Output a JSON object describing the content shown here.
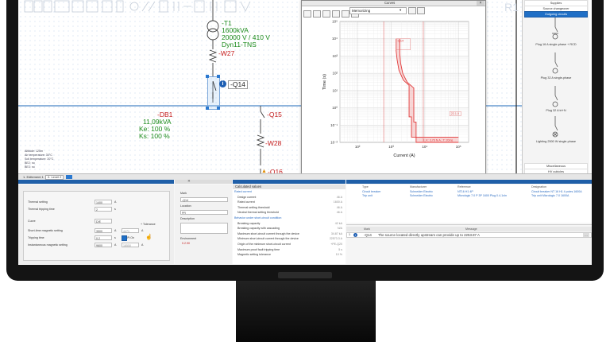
{
  "diagram": {
    "transformer": {
      "name": "-T1",
      "power": "1600kVA",
      "voltage": "20000 V / 410 V",
      "coupling": "Dyn11-TNS"
    },
    "cable_w27": "-W27",
    "breaker_q14": "-Q14",
    "breaker_q15": "-Q15",
    "cable_w28": "-W28",
    "breaker_q16": "-Q16",
    "db1": {
      "name": "-DB1",
      "power": "11,09kVA",
      "ke": "Ke: 100 %",
      "ks": "Ks: 100 %"
    },
    "env_notes": [
      "Altitude: 125m",
      "Air temperature: 30°C",
      "Soil temperature: 20°C",
      "BE2: no",
      "BE3: no"
    ],
    "faded_label": "R1"
  },
  "curve_window": {
    "title": "Curves",
    "mode": "Memorizing",
    "chart": {
      "y_axis_label": "Time (s)",
      "x_axis_label": "Current (A)",
      "y_ticks": [
        "10⁵",
        "10⁴",
        "10³",
        "10²",
        "10¹",
        "10⁰",
        "10⁻¹",
        "10⁻²"
      ],
      "x_ticks": [
        "10²",
        "10³",
        "10⁴",
        "10⁵"
      ],
      "top_label": "-Q14",
      "annotation_ik": "I_K: 3,76 N.A.; T: 20ms",
      "annotation_ir": "22.1.0"
    }
  },
  "chart_data": {
    "type": "line",
    "title": "",
    "xlabel": "Current (A)",
    "ylabel": "Time (s)",
    "x_scale": "log",
    "y_scale": "log",
    "xlim": [
      30,
      200000
    ],
    "ylim": [
      0.01,
      100000
    ],
    "series": [
      {
        "name": "-Q14",
        "points": [
          [
            1400,
            10000
          ],
          [
            1400,
            2000
          ],
          [
            1500,
            600
          ],
          [
            1700,
            150
          ],
          [
            2300,
            40
          ],
          [
            3400,
            20
          ],
          [
            3400,
            0.3
          ],
          [
            4000,
            0.3
          ],
          [
            4000,
            0.02
          ],
          [
            100000,
            0.02
          ]
        ]
      },
      {
        "name": "-Q14",
        "points": [
          [
            1800,
            10000
          ],
          [
            1800,
            1500
          ],
          [
            1900,
            400
          ],
          [
            2200,
            100
          ],
          [
            3000,
            30
          ],
          [
            4700,
            14
          ],
          [
            4700,
            0.15
          ],
          [
            5500,
            0.15
          ],
          [
            5500,
            0.01
          ],
          [
            100000,
            0.01
          ]
        ]
      }
    ]
  },
  "tabs": {
    "bottom": [
      "1. Editement 1",
      "2. Level 2"
    ]
  },
  "properties": {
    "thermal_setting": {
      "label": "Thermal setting",
      "value": "1400",
      "unit": "A"
    },
    "thermal_tripping_time": {
      "label": "Thermal tripping time",
      "value": "2",
      "unit": "s"
    },
    "curve": {
      "label": "Curve",
      "value": "D/E"
    },
    "tolerance": "+ Tolerance",
    "short_time_magnetic": {
      "label": "Short-time magnetic setting",
      "value": "3500",
      "unit": "A",
      "aux": "4471"
    },
    "tripping_time": {
      "label": "Tripping time",
      "value": "0.2",
      "unit": "s",
      "checkbox": "I²t On"
    },
    "instantaneous": {
      "label": "Instantaneous magnetic setting",
      "value": "9600",
      "unit": "A",
      "aux": "18550"
    }
  },
  "mark_panel": {
    "mark_label": "Mark",
    "mark_value": "-Q14",
    "location_label": "Location",
    "location_value": "PR",
    "description_label": "Description",
    "environment_label": "Environment",
    "env_value": "0.2.90"
  },
  "calc_panel": {
    "header": "Calculated values",
    "rows": [
      {
        "label": "Rated current",
        "value": "",
        "group": true
      },
      {
        "label": "Design current",
        "value": "46 A"
      },
      {
        "label": "Rated current",
        "value": "1600 A"
      },
      {
        "label": "Thermal setting threshold",
        "value": "46 A"
      },
      {
        "label": "Neutral thermal setting threshold",
        "value": "46 A"
      },
      {
        "label": "Behavior under short-circuit condition",
        "value": "",
        "group": true
      },
      {
        "label": "Breaking capacity",
        "value": "42 kA"
      },
      {
        "label": "Breaking capacity with cascading",
        "value": "N/A"
      },
      {
        "label": "Maximum short-circuit current through the device",
        "value": "34.87 kA"
      },
      {
        "label": "Minimum short-circuit current through the device",
        "value": "22573.3 A"
      },
      {
        "label": "Origin of the minimum short-circuit current",
        "value": "+PE-Q20"
      },
      {
        "label": "Maximum proof fault tripping time",
        "value": "5 s"
      },
      {
        "label": "Magnetic setting tolerance",
        "value": "10 %"
      }
    ]
  },
  "catalog": {
    "headers": [
      "Type",
      "Manufacturer",
      "Reference",
      "Designation"
    ],
    "rows": [
      {
        "type": "Circuit breaker",
        "manufacturer": "Schneider Electric",
        "reference": "NT16 H1 4P",
        "designation": "Circuit breaker NT 16 H1 4 poles 1600A"
      },
      {
        "type": "Trip unit",
        "manufacturer": "Schneider Electric",
        "reference": "Micrologic 7.0 P 3P 1600 Plug 0.4-1xIn",
        "designation": "Trip unit Micrologic 7.0 1600A"
      }
    ]
  },
  "messages": {
    "headers": [
      "Mark",
      "Message"
    ],
    "rows": [
      {
        "mark": "-Q14",
        "message": "The source located directly upstream can provide up to 2253.87 A"
      }
    ]
  },
  "sidebar": {
    "top_items": [
      "Supplies",
      "Source changeover",
      "Outgoing circuits"
    ],
    "symbols": [
      {
        "label": "Plug 16 A single-phase + RCD"
      },
      {
        "label": "Plug 32 A single-phase"
      },
      {
        "label": "Plug 32 A tri+N"
      },
      {
        "label": "Lighting 2500 W single-phase"
      }
    ],
    "bottom_items": [
      "Miscellaneous",
      "HV cubicles"
    ]
  },
  "colors": {
    "accent": "#1f6fc6",
    "curve": "#e03a3a",
    "diagram_green": "#1a8a1a",
    "selection": "#2b79d0"
  }
}
